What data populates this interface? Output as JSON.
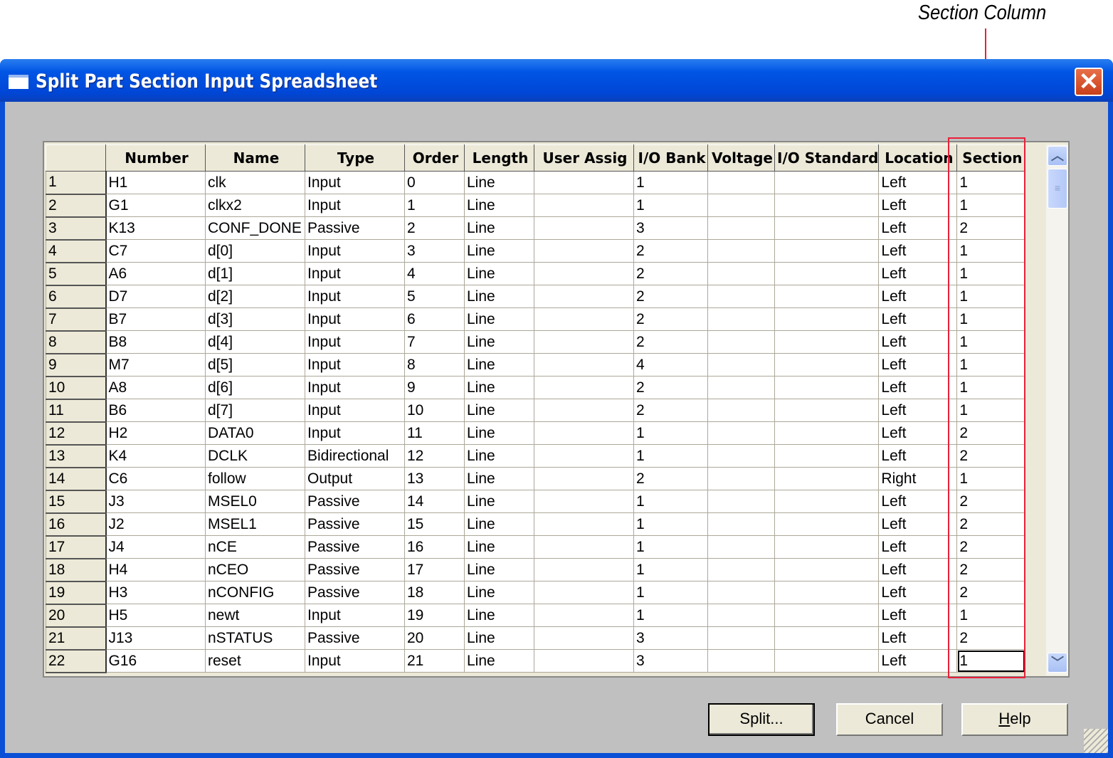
{
  "annotation": "Section Column",
  "window": {
    "title": "Split Part Section Input Spreadsheet"
  },
  "columns": [
    "",
    "Number",
    "Name",
    "Type",
    "Order",
    "Length",
    "User Assig",
    "I/O Bank",
    "Voltage",
    "I/O Standard",
    "Location",
    "Section"
  ],
  "rows": [
    [
      "1",
      "H1",
      "clk",
      "Input",
      "0",
      "Line",
      "",
      "1",
      "",
      "",
      "Left",
      "1"
    ],
    [
      "2",
      "G1",
      "clkx2",
      "Input",
      "1",
      "Line",
      "",
      "1",
      "",
      "",
      "Left",
      "1"
    ],
    [
      "3",
      "K13",
      "CONF_DONE",
      "Passive",
      "2",
      "Line",
      "",
      "3",
      "",
      "",
      "Left",
      "2"
    ],
    [
      "4",
      "C7",
      "d[0]",
      "Input",
      "3",
      "Line",
      "",
      "2",
      "",
      "",
      "Left",
      "1"
    ],
    [
      "5",
      "A6",
      "d[1]",
      "Input",
      "4",
      "Line",
      "",
      "2",
      "",
      "",
      "Left",
      "1"
    ],
    [
      "6",
      "D7",
      "d[2]",
      "Input",
      "5",
      "Line",
      "",
      "2",
      "",
      "",
      "Left",
      "1"
    ],
    [
      "7",
      "B7",
      "d[3]",
      "Input",
      "6",
      "Line",
      "",
      "2",
      "",
      "",
      "Left",
      "1"
    ],
    [
      "8",
      "B8",
      "d[4]",
      "Input",
      "7",
      "Line",
      "",
      "2",
      "",
      "",
      "Left",
      "1"
    ],
    [
      "9",
      "M7",
      "d[5]",
      "Input",
      "8",
      "Line",
      "",
      "4",
      "",
      "",
      "Left",
      "1"
    ],
    [
      "10",
      "A8",
      "d[6]",
      "Input",
      "9",
      "Line",
      "",
      "2",
      "",
      "",
      "Left",
      "1"
    ],
    [
      "11",
      "B6",
      "d[7]",
      "Input",
      "10",
      "Line",
      "",
      "2",
      "",
      "",
      "Left",
      "1"
    ],
    [
      "12",
      "H2",
      "DATA0",
      "Input",
      "11",
      "Line",
      "",
      "1",
      "",
      "",
      "Left",
      "2"
    ],
    [
      "13",
      "K4",
      "DCLK",
      "Bidirectional",
      "12",
      "Line",
      "",
      "1",
      "",
      "",
      "Left",
      "2"
    ],
    [
      "14",
      "C6",
      "follow",
      "Output",
      "13",
      "Line",
      "",
      "2",
      "",
      "",
      "Right",
      "1"
    ],
    [
      "15",
      "J3",
      "MSEL0",
      "Passive",
      "14",
      "Line",
      "",
      "1",
      "",
      "",
      "Left",
      "2"
    ],
    [
      "16",
      "J2",
      "MSEL1",
      "Passive",
      "15",
      "Line",
      "",
      "1",
      "",
      "",
      "Left",
      "2"
    ],
    [
      "17",
      "J4",
      "nCE",
      "Passive",
      "16",
      "Line",
      "",
      "1",
      "",
      "",
      "Left",
      "2"
    ],
    [
      "18",
      "H4",
      "nCEO",
      "Passive",
      "17",
      "Line",
      "",
      "1",
      "",
      "",
      "Left",
      "2"
    ],
    [
      "19",
      "H3",
      "nCONFIG",
      "Passive",
      "18",
      "Line",
      "",
      "1",
      "",
      "",
      "Left",
      "2"
    ],
    [
      "20",
      "H5",
      "newt",
      "Input",
      "19",
      "Line",
      "",
      "1",
      "",
      "",
      "Left",
      "1"
    ],
    [
      "21",
      "J13",
      "nSTATUS",
      "Passive",
      "20",
      "Line",
      "",
      "3",
      "",
      "",
      "Left",
      "2"
    ],
    [
      "22",
      "G16",
      "reset",
      "Input",
      "21",
      "Line",
      "",
      "3",
      "",
      "",
      "Left",
      "1"
    ]
  ],
  "buttons": {
    "split": "Split...",
    "cancel": "Cancel",
    "help": "Help"
  }
}
